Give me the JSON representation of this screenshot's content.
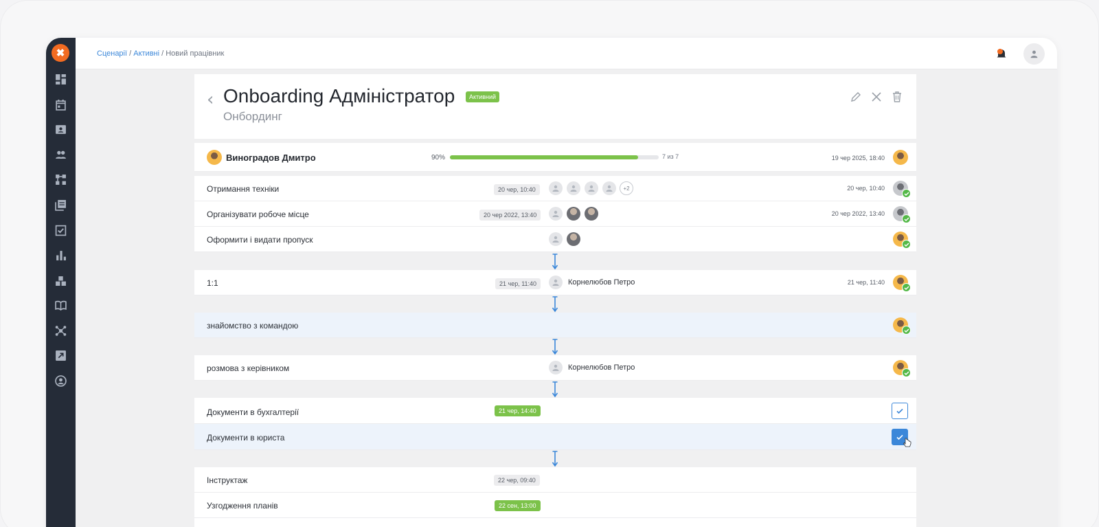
{
  "breadcrumb": {
    "part1": "Сценарії",
    "sep1": " / ",
    "part2": "Активні",
    "sep2": " / ",
    "current": "Новий працівник"
  },
  "logo": {
    "mark": "✖"
  },
  "header": {
    "back": "‹",
    "title": "Onboarding Адміністратор",
    "status": "Активний",
    "subtitle": "Онбординг"
  },
  "progress": {
    "name": "Виноградов Дмитро",
    "percent_label": "90%",
    "percent": 90,
    "count": "7 из 7",
    "date": "19 чер 2025, 18:40"
  },
  "tasks": [
    {
      "label": "Отримання техніки",
      "date": "20 чер, 10:40",
      "right_date": "20 чер, 10:40",
      "more": "+2"
    },
    {
      "label": "Організувати робоче місце",
      "date": "20 чер 2022, 13:40",
      "right_date": "20 чер 2022, 13:40"
    },
    {
      "label": "Оформити і видати пропуск"
    },
    {
      "label": "1:1",
      "date": "21 чер, 11:40",
      "assignee": "Корнелюбов Петро",
      "right_date": "21 чер, 11:40"
    },
    {
      "label": "знайомство з командою"
    },
    {
      "label": "розмова з керівником",
      "assignee": "Корнелюбов Петро"
    },
    {
      "label": "Документи в бухгалтерії",
      "date": "21 чер, 14:40"
    },
    {
      "label": "Документи в юриста"
    },
    {
      "label": "Інструктаж",
      "date": "22 чер, 09:40"
    },
    {
      "label": "Узгодження планів",
      "date": "22 сен, 13:00"
    }
  ],
  "colors": {
    "accent": "#3b87d9",
    "success": "#7cc24a",
    "sidebar": "#252c38",
    "brand": "#f26b21"
  }
}
